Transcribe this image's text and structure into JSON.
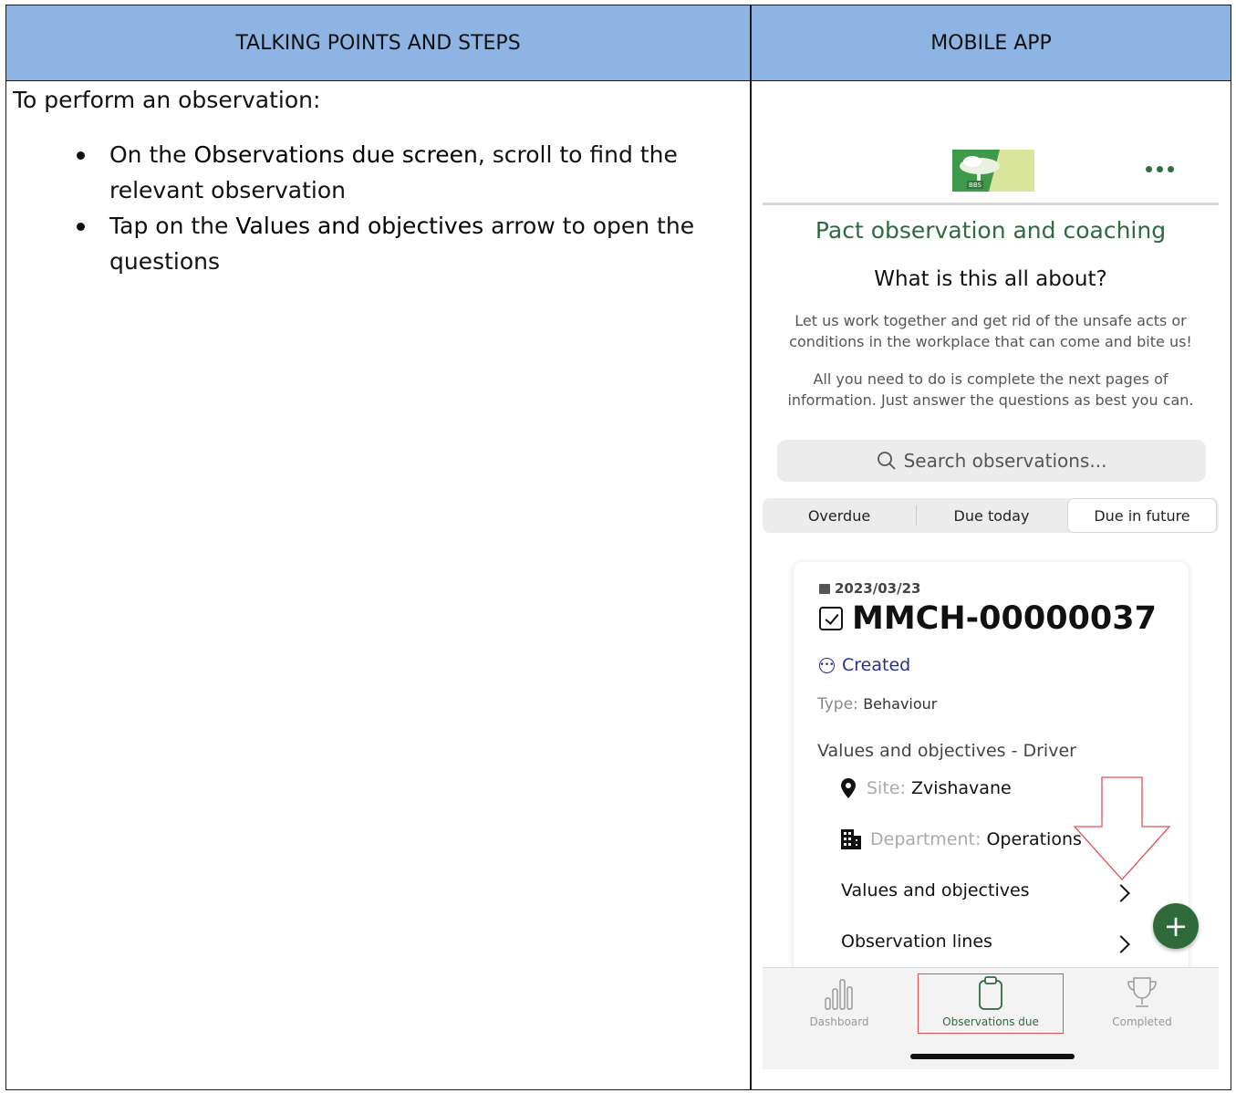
{
  "header": {
    "left_title": "TALKING POINTS AND STEPS",
    "right_title": "MOBILE APP"
  },
  "instructions": {
    "intro": "To perform an observation:",
    "steps": [
      {
        "pre": "On the ",
        "bold": "Observations due screen",
        "post": ", scroll to find the relevant observation"
      },
      {
        "pre": "Tap on the ",
        "bold": "Values and objectives",
        "post": " arrow to open the questions"
      }
    ]
  },
  "app": {
    "logo_text": "BBS",
    "title": "Pact observation and coaching",
    "subtitle": "What is this all about?",
    "desc1": "Let us work together and get rid of the unsafe acts or conditions in the workplace that can come and bite us!",
    "desc2": "All you need to do is complete the next pages of information. Just answer the questions as best you can.",
    "search_placeholder": "Search observations...",
    "segments": [
      "Overdue",
      "Due today",
      "Due in future"
    ],
    "selected_segment": "Due in future",
    "card": {
      "date": "2023/03/23",
      "code": "MMCH-00000037",
      "status": "Created",
      "type_label": "Type:",
      "type_value": "Behaviour",
      "values_driver": "Values and objectives - Driver",
      "site_label": "Site:",
      "site_value": "Zvishavane",
      "dept_label": "Department:",
      "dept_value": "Operations",
      "link1": "Values and objectives",
      "link2": "Observation lines"
    },
    "fab_label": "+",
    "tabs": [
      "Dashboard",
      "Observations due",
      "Completed"
    ],
    "active_tab": "Observations due"
  },
  "colors": {
    "header_bg": "#8eb4e3",
    "brand_green": "#2f6a3a",
    "status_blue": "#2a2f8c",
    "annotation_red": "#e05050"
  }
}
